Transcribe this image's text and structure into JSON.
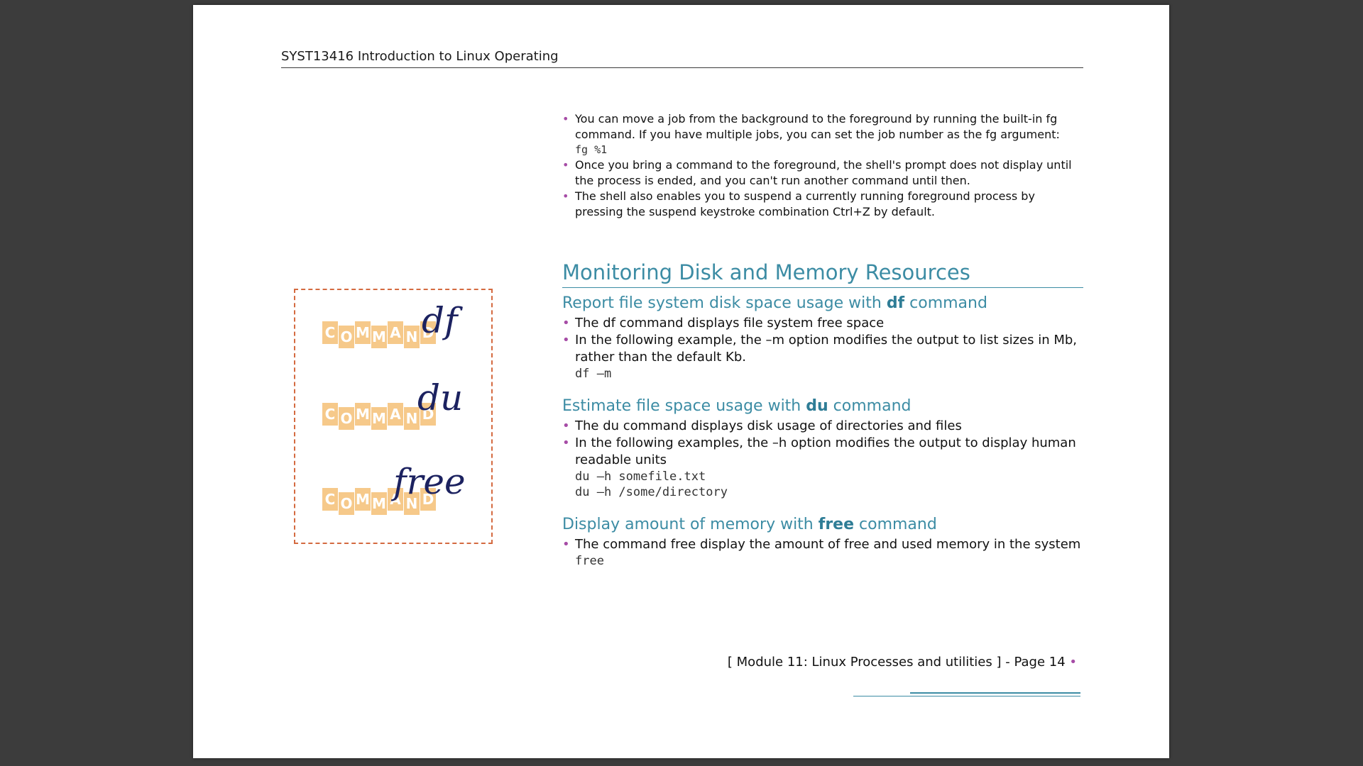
{
  "header": {
    "title": "SYST13416 Introduction to Linux Operating"
  },
  "top_bullets": {
    "items": [
      "You can move a job from the background to the foreground by running the built-in fg command. If you have multiple jobs, you can set the job number as the fg argument:",
      "Once you bring a command to the foreground, the shell's prompt does not display until the process is ended, and you can't run another command until then.",
      "The shell also enables you to suspend a currently running foreground process by pressing the suspend keystroke combination Ctrl+Z by default."
    ],
    "code": "fg %1"
  },
  "section_title": "Monitoring Disk and Memory Resources",
  "df": {
    "heading_pre": "Report file system disk space usage with ",
    "heading_cmd": "df",
    "heading_post": " command",
    "items": [
      "The df command displays file system free space",
      "In the following example, the –m option modifies the output to list sizes in Mb, rather than the default Kb."
    ],
    "code": "df –m"
  },
  "du": {
    "heading_pre": "Estimate file space usage with ",
    "heading_cmd": "du",
    "heading_post": " command",
    "items": [
      "The du command displays disk usage of directories and files",
      "In the following examples, the –h option modifies the output to display human readable units"
    ],
    "code1": "du –h somefile.txt",
    "code2": "du –h /some/directory"
  },
  "free": {
    "heading_pre": "Display amount of memory with ",
    "heading_cmd": "free",
    "heading_post": " command",
    "items": [
      "The command free display the amount of free and used memory in the system"
    ],
    "code": "free"
  },
  "figure": {
    "tile_letters": [
      "C",
      "O",
      "M",
      "M",
      "A",
      "N",
      "D"
    ],
    "df_script": "df",
    "du_script": "du",
    "free_script": "free"
  },
  "footer": {
    "text": "[ Module 11:  Linux Processes and utilities ] - Page 14",
    "dot": "•"
  }
}
